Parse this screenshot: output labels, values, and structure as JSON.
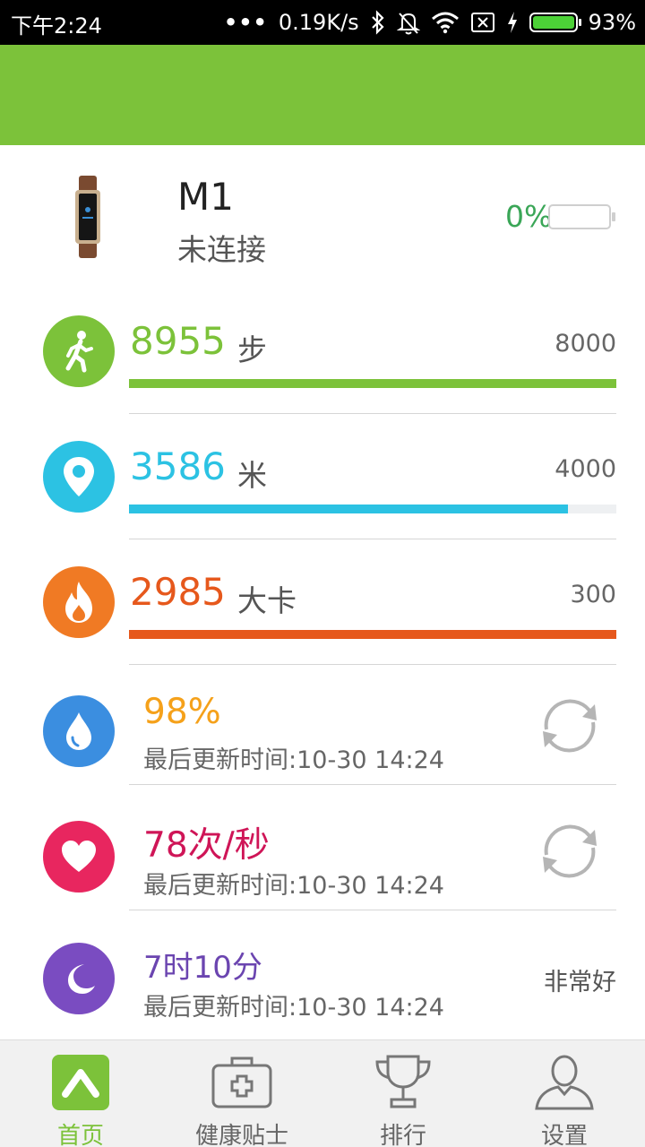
{
  "status_bar": {
    "time": "下午2:24",
    "dots": "•••",
    "net_speed": "0.19K/s",
    "battery": "93%",
    "icons": [
      "bluetooth-icon",
      "mute-bell-icon",
      "wifi-icon",
      "sim-card-icon",
      "charging-icon",
      "battery-icon"
    ]
  },
  "colors": {
    "header": "#7cc23a",
    "steps": "#7cc23a",
    "distance": "#2cc2e3",
    "calories": "#e6581c",
    "oxygen": "#f5a11a",
    "heart": "#cf1557",
    "sleep": "#6b45b0"
  },
  "device": {
    "name": "M1",
    "status": "未连接",
    "battery_pct": "0%",
    "battery_level": 0
  },
  "metrics": [
    {
      "id": "steps",
      "value": "8955",
      "unit": "步",
      "goal": "8000",
      "progress": 1.0
    },
    {
      "id": "distance",
      "value": "3586",
      "unit": "米",
      "goal": "4000",
      "progress": 0.9
    },
    {
      "id": "calories",
      "value": "2985",
      "unit": "大卡",
      "goal": "300",
      "progress": 1.0
    }
  ],
  "readings": [
    {
      "id": "oxygen",
      "value": "98%",
      "updated": "最后更新时间:10-30 14:24"
    },
    {
      "id": "heart",
      "value": "78次/秒",
      "updated": "最后更新时间:10-30 14:24"
    },
    {
      "id": "sleep",
      "value": "7时10分",
      "updated": "最后更新时间:10-30 14:24",
      "quality": "非常好"
    }
  ],
  "nav": [
    {
      "label": "首页",
      "active": true
    },
    {
      "label": "健康贴士",
      "active": false
    },
    {
      "label": "排行",
      "active": false
    },
    {
      "label": "设置",
      "active": false
    }
  ]
}
